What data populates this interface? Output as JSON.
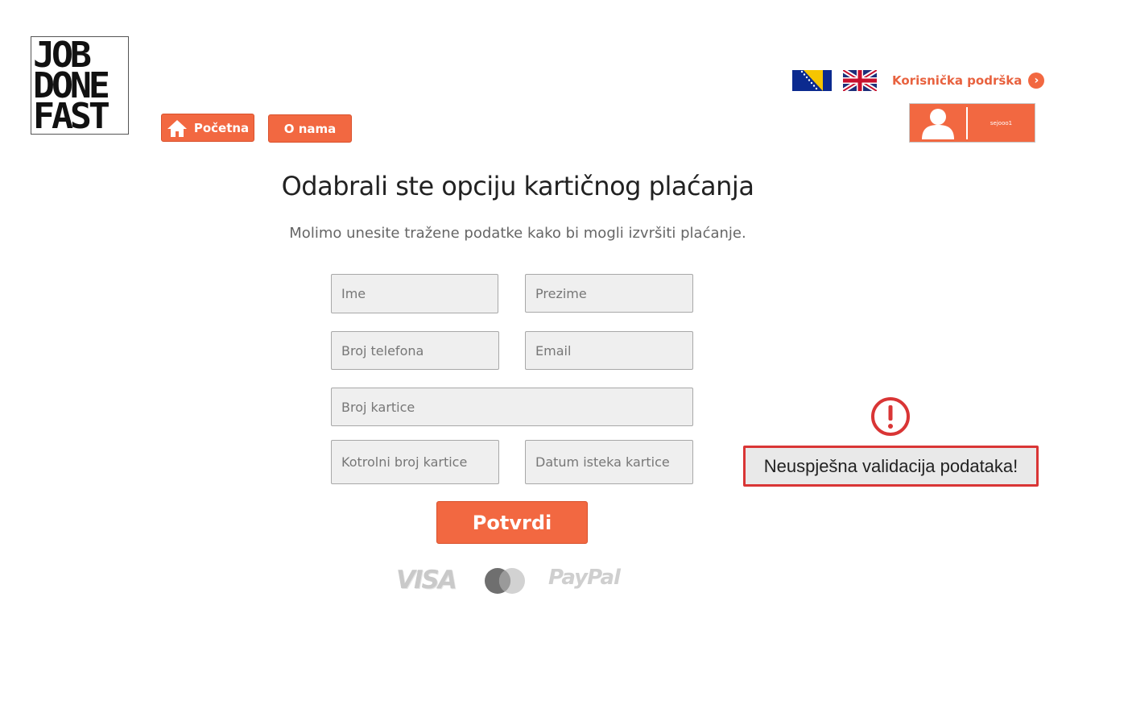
{
  "logo": {
    "line1": "JOB",
    "line2": "DONE",
    "line3": "FAST"
  },
  "nav": {
    "home_label": "Početna",
    "about_label": "O nama"
  },
  "header": {
    "support_label": "Korisnička podrška",
    "flags": [
      "bosnian-flag",
      "english-flag"
    ],
    "username": "sejooo1"
  },
  "page": {
    "title": "Odabrali ste opciju kartičnog plaćanja",
    "subtitle": "Molimo unesite tražene podatke kako bi mogli izvršiti plaćanje."
  },
  "form": {
    "ime_placeholder": "Ime",
    "prezime_placeholder": "Prezime",
    "telefon_placeholder": "Broj telefona",
    "email_placeholder": "Email",
    "kartica_placeholder": "Broj kartice",
    "kontrolni_placeholder": "Kotrolni broj kartice",
    "datum_placeholder": "Datum isteka kartice",
    "submit_label": "Potvrdi"
  },
  "payment": {
    "visa": "VISA",
    "mastercard": "mastercard-logo",
    "paypal": "PayPal"
  },
  "error": {
    "message": "Neuspješna validacija podataka!",
    "icon": "exclamation-circle-icon"
  },
  "colors": {
    "accent": "#f26841",
    "error": "#d93535",
    "field_bg": "#efefef"
  }
}
